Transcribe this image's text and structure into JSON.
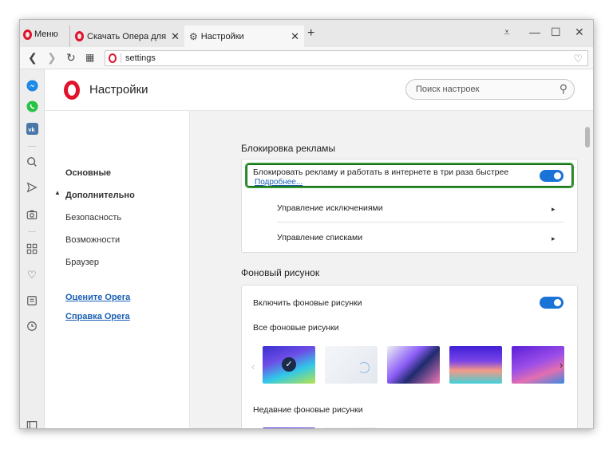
{
  "browser": {
    "menu_label": "Меню",
    "tabs": [
      {
        "label": "Скачать Опера для компьютера"
      },
      {
        "label": "Настройки"
      }
    ],
    "url": "settings"
  },
  "header": {
    "title": "Настройки",
    "search_placeholder": "Поиск настроек"
  },
  "leftnav": {
    "items": [
      "Основные",
      "Дополнительно",
      "Безопасность",
      "Возможности",
      "Браузер"
    ],
    "links": [
      "Оцените Opera",
      "Справка Opera"
    ]
  },
  "adblock": {
    "section_title": "Блокировка рекламы",
    "toggle_label": "Блокировать рекламу и работать в интернете в три раза быстрее",
    "more_link": "Подробнее...",
    "toggle_on": true,
    "exceptions_label": "Управление исключениями",
    "lists_label": "Управление списками"
  },
  "wallpaper": {
    "section_title": "Фоновый рисунок",
    "toggle_label": "Включить фоновые рисунки",
    "toggle_on": true,
    "all_label": "Все фоновые рисунки",
    "recent_label": "Недавние фоновые рисунки"
  },
  "icons": {
    "sidebar": [
      "messenger-icon",
      "whatsapp-icon",
      "vk-icon",
      "search-icon",
      "send-icon",
      "camera-icon",
      "speed-dial-icon",
      "heart-icon",
      "news-icon",
      "history-icon",
      "panel-icon"
    ]
  },
  "colors": {
    "accent": "#1a73d6",
    "opera_red": "#e0132b",
    "highlight": "#2f9a2f"
  }
}
